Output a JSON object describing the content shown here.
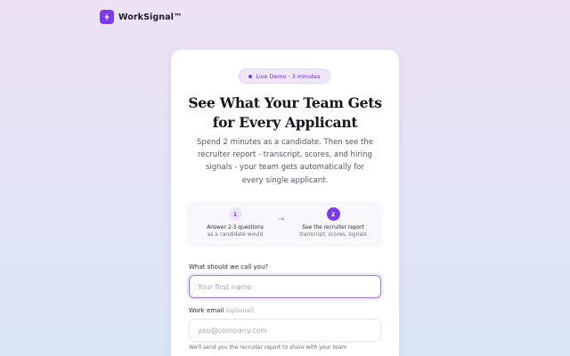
{
  "brand": {
    "name": "WorkSignal™",
    "logo_icon": "lightning-bolt-icon",
    "accent_color": "#7c3aed"
  },
  "badge": {
    "label": "Live Demo · 3 minutes"
  },
  "hero": {
    "title_line1": "See What Your Team Gets",
    "title_line2": "for Every Applicant",
    "subtitle_line1": "Spend 2 minutes as a candidate. Then see the",
    "subtitle_line2": "recruiter report - transcript, scores, and hiring",
    "subtitle_line3": "signals - your team gets automatically for",
    "subtitle_line4": "every single applicant."
  },
  "steps": [
    {
      "number": "1",
      "line1": "Answer 2-3 questions",
      "line2": "as a candidate would",
      "state": "upcoming"
    },
    {
      "number": "2",
      "line1": "See the recruiter report",
      "line2": "transcript, scores, signals",
      "state": "active"
    }
  ],
  "step_arrow": "→",
  "form": {
    "name_label": "What should we call you?",
    "name_placeholder": "Your first name",
    "email_label": "Work email",
    "email_optional": "(optional)",
    "email_placeholder": "you@company.com",
    "email_hint": "We'll send you the recruiter report to share with your team"
  }
}
